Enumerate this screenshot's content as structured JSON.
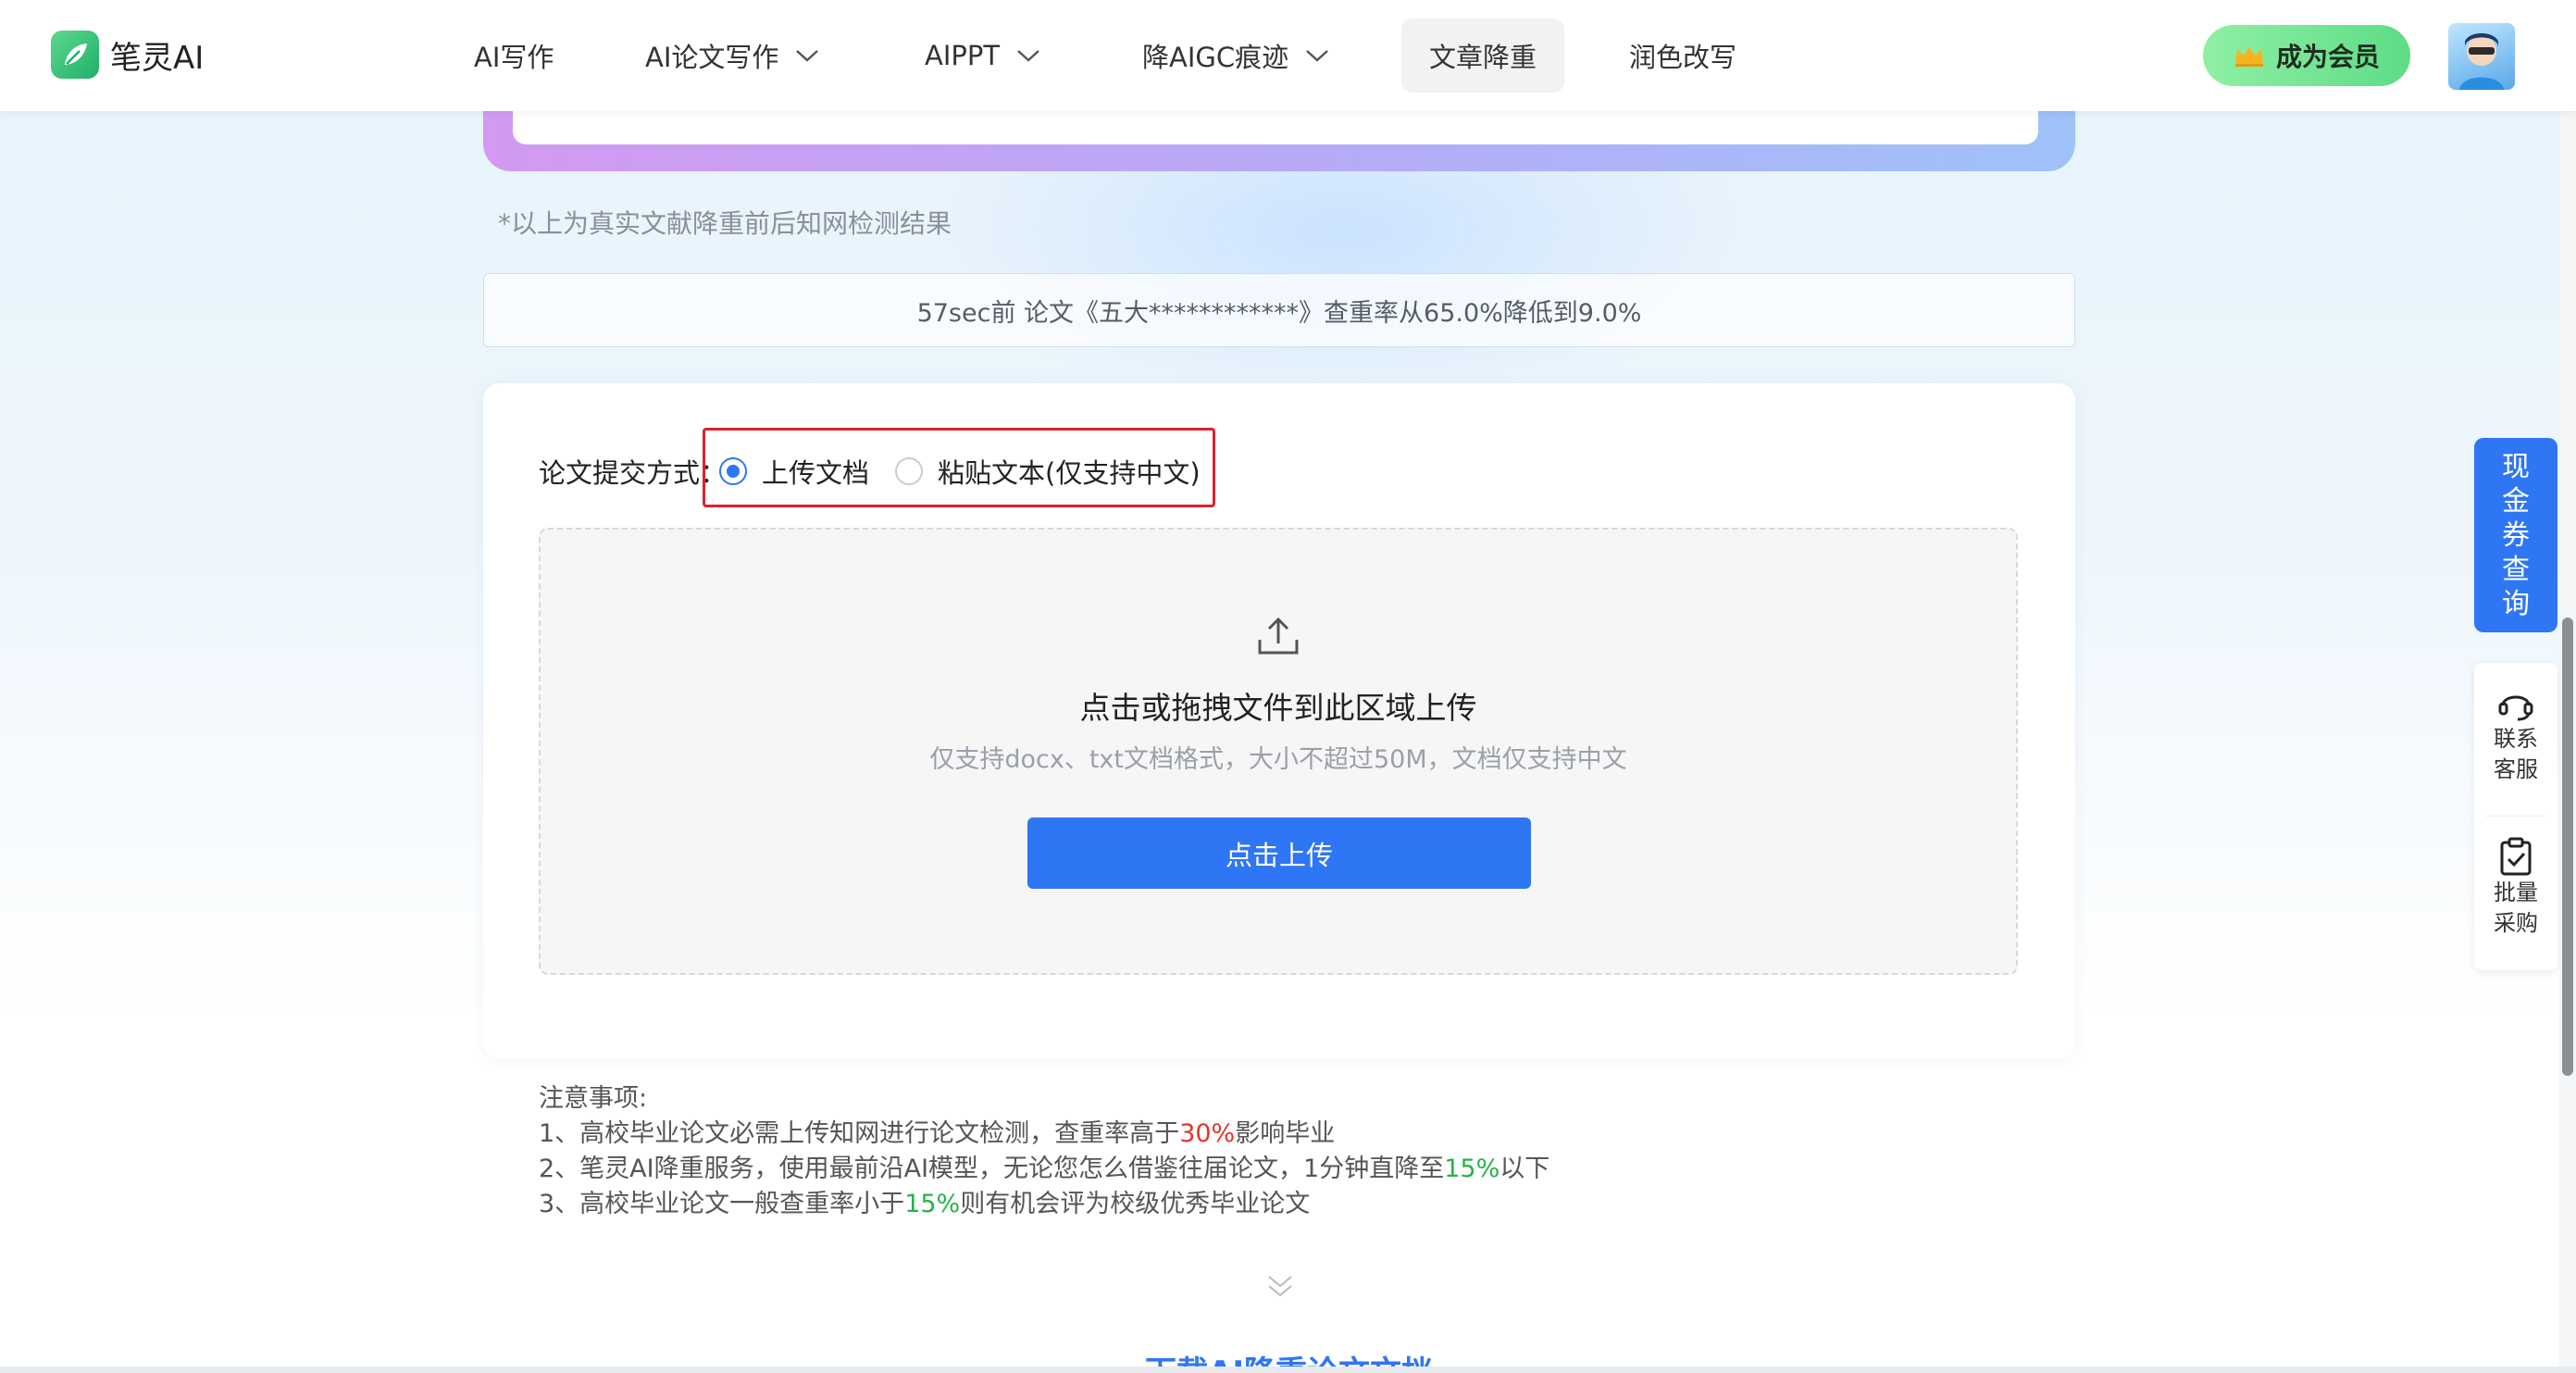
{
  "header": {
    "logo_text": "笔灵AI",
    "nav": [
      {
        "label": "AI写作",
        "dropdown": false
      },
      {
        "label": "AI论文写作",
        "dropdown": true
      },
      {
        "label": "AIPPT",
        "dropdown": true
      },
      {
        "label": "降AIGC痕迹",
        "dropdown": true
      },
      {
        "label": "文章降重",
        "dropdown": false,
        "active": true
      },
      {
        "label": "润色改写",
        "dropdown": false
      }
    ],
    "member_label": "成为会员"
  },
  "notice_top": "*以上为真实文献降重前后知网检测结果",
  "ticker": "57sec前 论文《五大************》查重率从65.0%降低到9.0%",
  "submit": {
    "label": "论文提交方式：",
    "options": [
      {
        "label": "上传文档",
        "checked": true
      },
      {
        "label": "粘贴文本(仅支持中文)",
        "checked": false
      }
    ]
  },
  "upload": {
    "title": "点击或拖拽文件到此区域上传",
    "hint": "仅支持docx、txt文档格式，大小不超过50M，文档仅支持中文",
    "button": "点击上传"
  },
  "notes": {
    "title": "注意事项:",
    "line1_pre": "1、高校毕业论文必需上传知网进行论文检测，查重率高于",
    "line1_hl": "30%",
    "line1_post": "影响毕业",
    "line2_pre": "2、笔灵AI降重服务，使用最前沿AI模型，无论您怎么借鉴往届论文，1分钟直降至",
    "line2_hl": "15%",
    "line2_post": "以下",
    "line3_pre": "3、高校毕业论文一般查重率小于",
    "line3_hl": "15%",
    "line3_post": "则有机会评为校级优秀毕业论文"
  },
  "bottom_heading": "下载AI降重论文文档",
  "side": {
    "voucher": [
      "现",
      "金",
      "券",
      "查",
      "询"
    ],
    "contact": [
      "联系",
      "客服"
    ],
    "bulk": [
      "批量",
      "采购"
    ]
  },
  "colors": {
    "primary": "#2f76f5",
    "highlight_red": "#e2352c",
    "highlight_green": "#27b24a",
    "selection_box": "#e0202a"
  }
}
